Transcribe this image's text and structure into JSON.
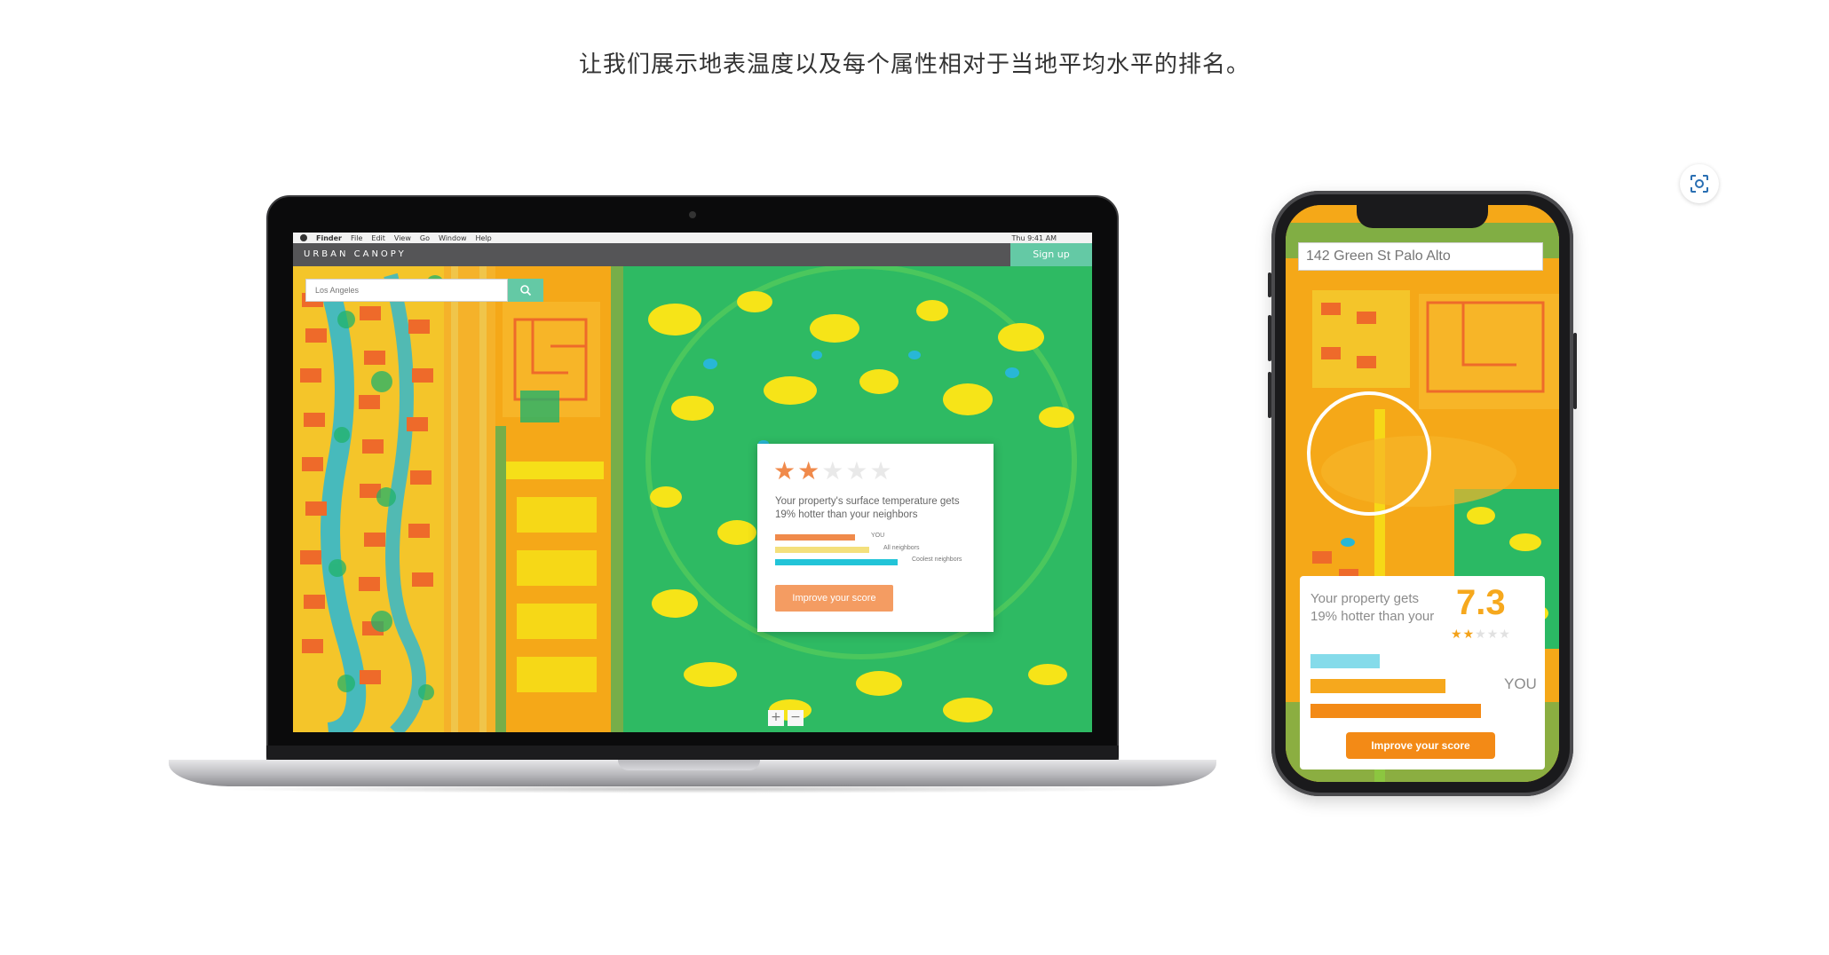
{
  "caption": "让我们展示地表温度以及每个属性相对于当地平均水平的排名。",
  "laptop": {
    "menubar": {
      "items": [
        "Finder",
        "File",
        "Edit",
        "View",
        "Go",
        "Window",
        "Help"
      ],
      "clock": "Thu 9:41 AM"
    },
    "brand": "URBAN CANOPY",
    "signup_label": "Sign up",
    "search": {
      "placeholder": "Los Angeles",
      "icon": "search-icon"
    },
    "rating_card": {
      "stars": {
        "filled": 2,
        "total": 5
      },
      "text": "Your property's surface temperature gets 19% hotter than your neighbors",
      "bars": [
        {
          "label": "YOU",
          "color": "#f08a4b",
          "value": 0.34
        },
        {
          "label": "All neighbors",
          "color": "#f4e07c",
          "value": 0.4
        },
        {
          "label": "Coolest neighbors",
          "color": "#22c4d8",
          "value": 0.52
        }
      ],
      "button_label": "Improve your score"
    },
    "zoom": {
      "plus": "+",
      "minus": "−"
    }
  },
  "phone": {
    "address": "142 Green St Palo Alto",
    "card_text": "Your property gets 19% hotter than your",
    "score": "7.3",
    "stars": {
      "filled": 2,
      "total": 5
    },
    "bars": [
      {
        "color": "#85dbea",
        "value": 0.39
      },
      {
        "color": "#f6a81d",
        "value": 0.76
      },
      {
        "color": "#f38a16",
        "value": 0.96
      }
    ],
    "you_label": "YOU",
    "button_label": "Improve your score"
  },
  "colors": {
    "heat_hot": "#f5a818",
    "heat_mid": "#f6e418",
    "heat_warm": "#ee6a2a",
    "heat_cool": "#21b36a",
    "heat_cold": "#22b8d8",
    "accent": "#64c9a5"
  },
  "zoom_icon": "scan-icon"
}
